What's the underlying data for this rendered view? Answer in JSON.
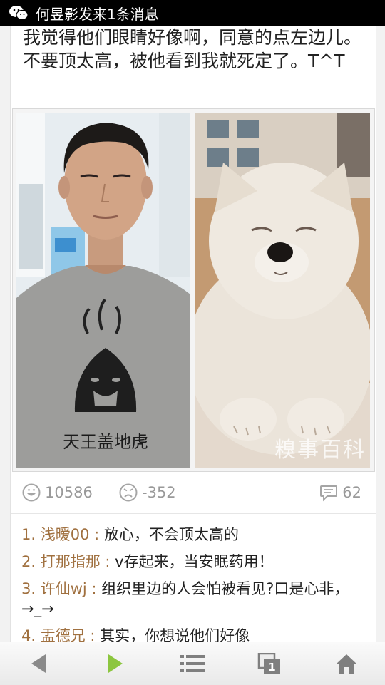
{
  "status_bar": {
    "notification": "何昱影发来1条消息",
    "app_icon": "wechat-icon"
  },
  "post": {
    "text": "我觉得他们眼睛好像啊，同意的点左边儿。不要顶太高，被他看到我就死定了。T^T",
    "image": {
      "watermark": "糗事百科",
      "shirt_text": "天王盖地虎",
      "left_caption": "young man in grey t-shirt",
      "right_caption": "white fluffy puppy with closed eyes"
    }
  },
  "stats": {
    "upvotes": "10586",
    "downvotes": "-352",
    "comments": "62",
    "icons": {
      "up": "smile-face-icon",
      "down": "frown-face-icon",
      "comments": "speech-bubble-icon"
    }
  },
  "comments": [
    {
      "index": "1.",
      "user": "浅暧00",
      "sep": " : ",
      "text": "放心，不会顶太高的"
    },
    {
      "index": "2.",
      "user": "打那指那",
      "sep": " : ",
      "text": "v存起来，当安眠药用！"
    },
    {
      "index": "3.",
      "user": "许仙wj",
      "sep": " : ",
      "text": "组织里边的人会怕被看见?口是心非，→_→"
    },
    {
      "index": "4.",
      "user": "盂德兄",
      "sep": " : ",
      "text": "其实，你想说他们好像"
    }
  ],
  "nav": {
    "tab_count": "1",
    "colors": {
      "back": "#8a8a8a",
      "forward": "#8cc63f",
      "menu": "#7f7f7f",
      "tabs": "#7f7f7f",
      "home": "#7f7f7f"
    }
  },
  "colors": {
    "username": "#a0703f",
    "stat_text": "#999999",
    "status_bg": "#000000"
  }
}
